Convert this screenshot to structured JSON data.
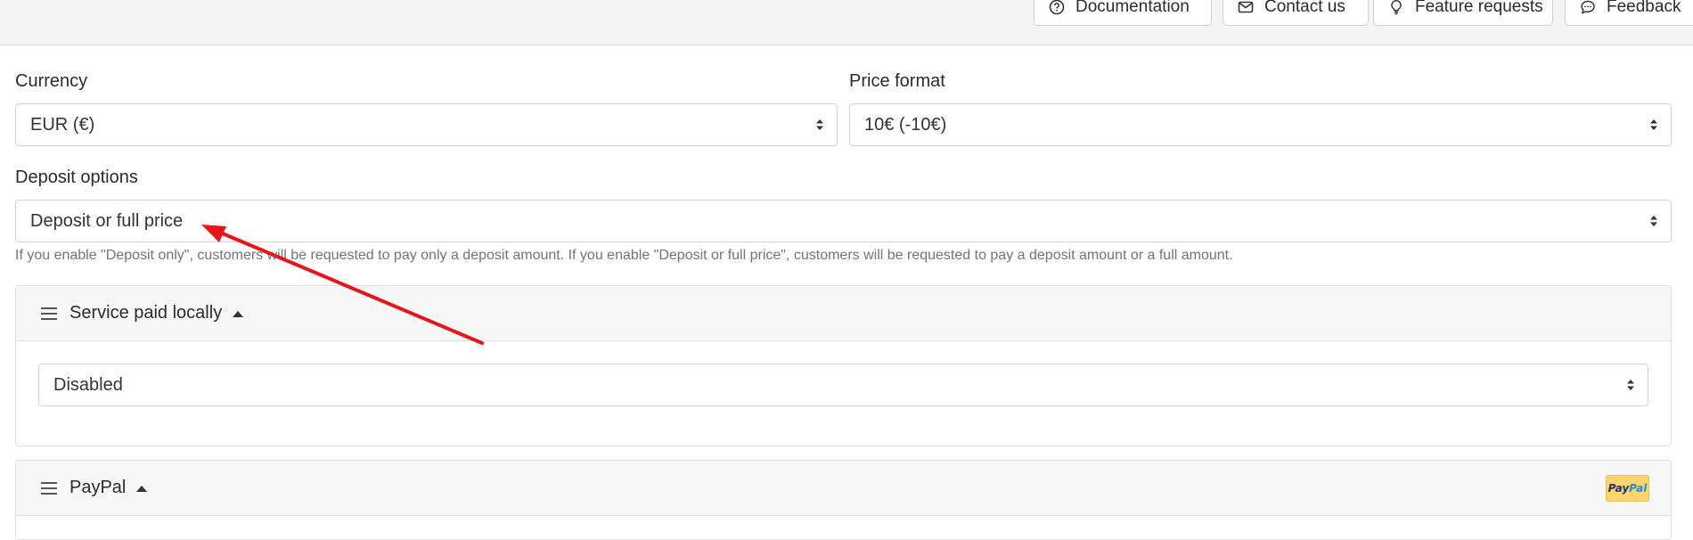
{
  "header": {
    "buttons": [
      {
        "label": "Documentation",
        "icon": "question-circle-icon"
      },
      {
        "label": "Contact us",
        "icon": "envelope-icon"
      },
      {
        "label": "Feature requests",
        "icon": "lightbulb-icon"
      },
      {
        "label": "Feedback",
        "icon": "chat-dots-icon"
      }
    ]
  },
  "form": {
    "currency": {
      "label": "Currency",
      "value": "EUR (€)"
    },
    "price_format": {
      "label": "Price format",
      "value": "10€ (-10€)"
    },
    "deposit": {
      "label": "Deposit options",
      "value": "Deposit or full price",
      "help": "If you enable \"Deposit only\", customers will be requested to pay only a deposit amount. If you enable \"Deposit or full price\", customers will be requested to pay a deposit amount or a full amount."
    }
  },
  "sections": [
    {
      "title": "Service paid locally",
      "select_value": "Disabled"
    },
    {
      "title": "PayPal",
      "logo_text_1": "Pay",
      "logo_text_2": "Pal"
    }
  ],
  "colors": {
    "annotation_arrow": "#e8141a",
    "paypal_badge": "#ffd56b"
  }
}
